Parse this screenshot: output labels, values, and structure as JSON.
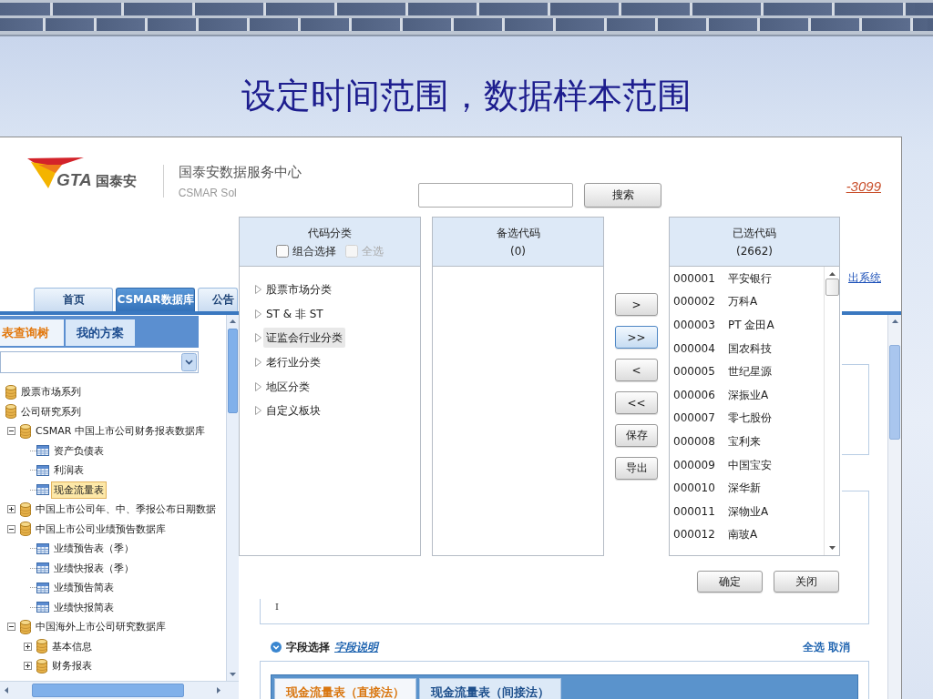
{
  "slide_title": "设定时间范围，数据样本范围",
  "header": {
    "logo_text": "GTA",
    "logo_name": "国泰安",
    "site_title": "国泰安数据服务中心",
    "site_subtitle": "CSMAR Sol",
    "phone_link": "-3099",
    "logout_link": "出系统"
  },
  "nav_tabs": [
    {
      "label": "首页",
      "selected": false
    },
    {
      "label": "CSMAR数据库",
      "selected": true
    },
    {
      "label": "公告",
      "selected": false
    }
  ],
  "sidebar": {
    "tabs": [
      {
        "label": "表查询树",
        "selected": true
      },
      {
        "label": "我的方案",
        "selected": false
      }
    ],
    "tree": [
      {
        "label": "股票市场系列",
        "kind": "database",
        "selected": false
      },
      {
        "label": "公司研究系列",
        "kind": "database",
        "selected": false,
        "children": [
          {
            "label": "CSMAR 中国上市公司财务报表数据库",
            "kind": "database",
            "expanded": true,
            "selected": false,
            "children": [
              {
                "label": "资产负债表",
                "kind": "table",
                "selected": false
              },
              {
                "label": "利润表",
                "kind": "table",
                "selected": false
              },
              {
                "label": "现金流量表",
                "kind": "table",
                "selected": true
              }
            ]
          },
          {
            "label": "中国上市公司年、中、季报公布日期数据",
            "kind": "database",
            "expanded": false,
            "selected": false
          },
          {
            "label": "中国上市公司业绩预告数据库",
            "kind": "database",
            "expanded": true,
            "selected": false,
            "children": [
              {
                "label": "业绩预告表（季）",
                "kind": "table",
                "selected": false
              },
              {
                "label": "业绩快报表（季）",
                "kind": "table",
                "selected": false
              },
              {
                "label": "业绩预告简表",
                "kind": "table",
                "selected": false
              },
              {
                "label": "业绩快报简表",
                "kind": "table",
                "selected": false
              }
            ]
          },
          {
            "label": "中国海外上市公司研究数据库",
            "kind": "database",
            "expanded": true,
            "selected": false,
            "children": [
              {
                "label": "基本信息",
                "kind": "database",
                "expanded": false,
                "selected": false
              },
              {
                "label": "财务报表",
                "kind": "database",
                "expanded": false,
                "selected": false
              }
            ]
          }
        ]
      }
    ]
  },
  "dialog": {
    "search_button": "搜索",
    "category_panel": {
      "title": "代码分类",
      "options": [
        {
          "label": "组合选择",
          "checked": false,
          "disabled": false
        },
        {
          "label": "全选",
          "checked": false,
          "disabled": true
        }
      ],
      "items": [
        {
          "label": "股票市场分类",
          "selected": false
        },
        {
          "label": "ST & 非 ST",
          "selected": false
        },
        {
          "label": "证监会行业分类",
          "selected": true
        },
        {
          "label": "老行业分类",
          "selected": false
        },
        {
          "label": "地区分类",
          "selected": false
        },
        {
          "label": "自定义板块",
          "selected": false
        }
      ]
    },
    "candidate_panel": {
      "title": "备选代码",
      "count": "(0)"
    },
    "transfer_buttons": [
      {
        "label": ">",
        "focused": false
      },
      {
        "label": ">>",
        "focused": true
      },
      {
        "label": "<",
        "focused": false
      },
      {
        "label": "<<",
        "focused": false
      },
      {
        "label": "保存",
        "focused": false
      },
      {
        "label": "导出",
        "focused": false
      }
    ],
    "selected_panel": {
      "title": "已选代码",
      "count": "(2662)",
      "rows": [
        {
          "code": "000001",
          "name": "平安银行"
        },
        {
          "code": "000002",
          "name": "万科A"
        },
        {
          "code": "000003",
          "name": "PT 金田A"
        },
        {
          "code": "000004",
          "name": "国农科技"
        },
        {
          "code": "000005",
          "name": "世纪星源"
        },
        {
          "code": "000006",
          "name": "深振业A"
        },
        {
          "code": "000007",
          "name": "零七股份"
        },
        {
          "code": "000008",
          "name": "宝利来"
        },
        {
          "code": "000009",
          "name": "中国宝安"
        },
        {
          "code": "000010",
          "name": "深华新"
        },
        {
          "code": "000011",
          "name": "深物业A"
        },
        {
          "code": "000012",
          "name": "南玻A"
        }
      ]
    },
    "footer_buttons": [
      "确定",
      "关闭"
    ]
  },
  "main": {
    "panel_text": "I",
    "field_section": {
      "title": "字段选择",
      "help_link": "字段说明",
      "actions": [
        "全选",
        "取消"
      ]
    },
    "table_tabs": [
      {
        "label": "现金流量表（直接法）",
        "selected": true
      },
      {
        "label": "现金流量表（间接法）",
        "selected": false
      }
    ]
  }
}
